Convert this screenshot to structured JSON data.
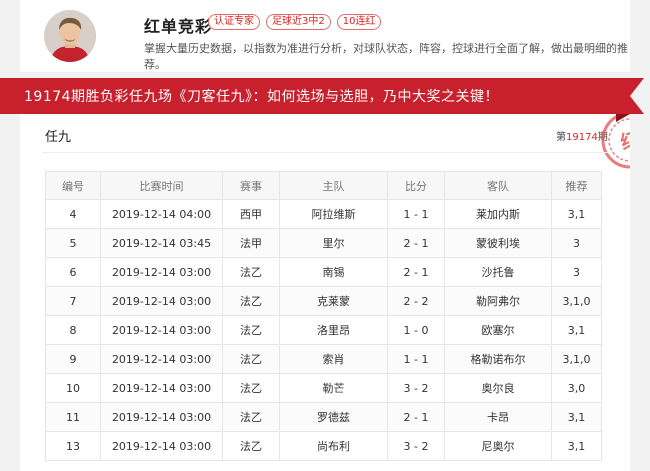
{
  "colors": {
    "accent": "#c8202c",
    "tag_red": "#dd2222",
    "stamp_red": "#e05050"
  },
  "profile": {
    "name": "红单竞彩",
    "tags": [
      "认证专家",
      "足球近3中2",
      "10连红"
    ],
    "description": "掌握大量历史数据，以指数为准进行分析，对球队状态，阵容，控球进行全面了解，做出最明细的推荐。"
  },
  "banner": {
    "title": "19174期胜负彩任九场《刀客任九》：如何选场与选胆，乃中大奖之关键！"
  },
  "panel": {
    "title": "任九",
    "issue_prefix": "第",
    "issue_number": "19174",
    "issue_suffix": "期",
    "stamp_text": "红"
  },
  "table": {
    "headers": [
      "编号",
      "比赛时间",
      "赛事",
      "主队",
      "比分",
      "客队",
      "推荐"
    ],
    "rows": [
      [
        "4",
        "2019-12-14 04:00",
        "西甲",
        "阿拉维斯",
        "1 - 1",
        "莱加内斯",
        "3,1"
      ],
      [
        "5",
        "2019-12-14 03:45",
        "法甲",
        "里尔",
        "2 - 1",
        "蒙彼利埃",
        "3"
      ],
      [
        "6",
        "2019-12-14 03:00",
        "法乙",
        "南锡",
        "2 - 1",
        "沙托鲁",
        "3"
      ],
      [
        "7",
        "2019-12-14 03:00",
        "法乙",
        "克莱蒙",
        "2 - 2",
        "勒阿弗尔",
        "3,1,0"
      ],
      [
        "8",
        "2019-12-14 03:00",
        "法乙",
        "洛里昂",
        "1 - 0",
        "欧塞尔",
        "3,1"
      ],
      [
        "9",
        "2019-12-14 03:00",
        "法乙",
        "索肖",
        "1 - 1",
        "格勒诺布尔",
        "3,1,0"
      ],
      [
        "10",
        "2019-12-14 03:00",
        "法乙",
        "勒芒",
        "3 - 2",
        "奥尔良",
        "3,0"
      ],
      [
        "11",
        "2019-12-14 03:00",
        "法乙",
        "罗德兹",
        "2 - 1",
        "卡昂",
        "3,1"
      ],
      [
        "13",
        "2019-12-14 03:00",
        "法乙",
        "尚布利",
        "3 - 2",
        "尼奥尔",
        "3,1"
      ]
    ]
  }
}
